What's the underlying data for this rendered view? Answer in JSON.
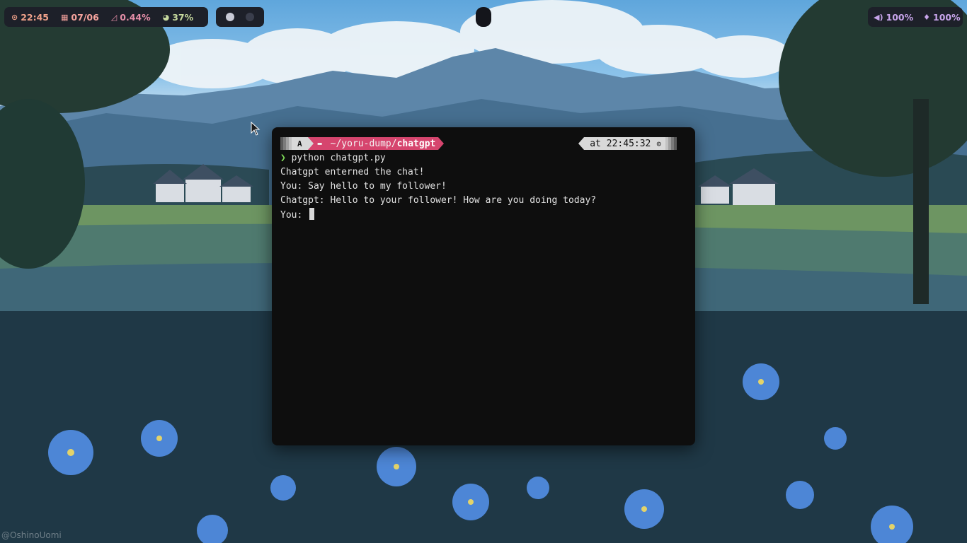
{
  "topbar": {
    "time": "22:45",
    "date": "07/06",
    "cpu": "0.44%",
    "battery": "37%",
    "volume": "100%",
    "mic": "100%"
  },
  "workspaces": [
    {
      "state": "active"
    },
    {
      "state": "inactive"
    }
  ],
  "terminal": {
    "prompt_user_icon": "A",
    "path_prefix": "~/yoru-dump/",
    "path_current": "chatgpt",
    "time_label": "at 22:45:32",
    "command": "python chatgpt.py",
    "output": [
      "Chatgpt enterned the chat!",
      "You: Say hello to my follower!",
      "Chatgpt: Hello to your follower! How are you doing today?"
    ],
    "input_prompt": "You: "
  },
  "watermark": "@OshinoUomi",
  "colors": {
    "bar_bg": "#1d2029",
    "time": "#f0a28a",
    "date": "#f6a39d",
    "cpu": "#e58ea8",
    "battery": "#c6d99e",
    "audio": "#c7a4ea",
    "path_accent": "#d6456e",
    "terminal_bg": "#0e0e0e",
    "command_arrow": "#7ed957"
  },
  "icons": [
    "clock-icon",
    "calendar-icon",
    "cpu-chart-icon",
    "battery-pie-icon",
    "volume-icon",
    "microphone-icon",
    "folder-icon",
    "prompt-arrow-icon",
    "mouse-pointer-icon"
  ]
}
